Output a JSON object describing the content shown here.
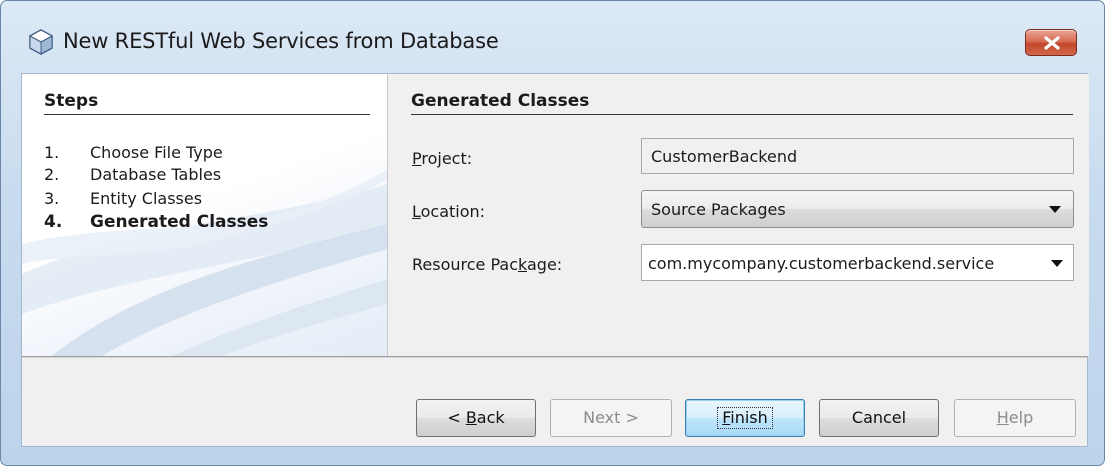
{
  "window": {
    "title": "New RESTful Web Services from Database",
    "icon": "netbeans-cube-icon",
    "close_icon": "close-icon"
  },
  "steps": {
    "title": "Steps",
    "items": [
      {
        "num": "1.",
        "label": "Choose File Type",
        "current": false
      },
      {
        "num": "2.",
        "label": "Database Tables",
        "current": false
      },
      {
        "num": "3.",
        "label": "Entity Classes",
        "current": false
      },
      {
        "num": "4.",
        "label": "Generated Classes",
        "current": true
      }
    ]
  },
  "panel": {
    "title": "Generated Classes",
    "project": {
      "label_pre": "",
      "label_mnemonic": "P",
      "label_post": "roject:",
      "value": "CustomerBackend"
    },
    "location": {
      "label_pre": "",
      "label_mnemonic": "L",
      "label_post": "ocation:",
      "value": "Source Packages"
    },
    "resource_package": {
      "label_pre": "Resource Pac",
      "label_mnemonic": "k",
      "label_post": "age:",
      "value": "com.mycompany.customerbackend.service"
    }
  },
  "buttons": {
    "back": {
      "pre": "< ",
      "mnemonic": "B",
      "post": "ack"
    },
    "next": {
      "label": "Next >"
    },
    "finish": {
      "pre": "",
      "mnemonic": "F",
      "post": "inish"
    },
    "cancel": {
      "label": "Cancel"
    },
    "help": {
      "pre": "",
      "mnemonic": "H",
      "post": "elp"
    }
  },
  "colors": {
    "titlebar": "#c9dcef",
    "close_button": "#c2472c",
    "content_bg": "#f0f0f0",
    "default_button": "#bee6fd"
  }
}
